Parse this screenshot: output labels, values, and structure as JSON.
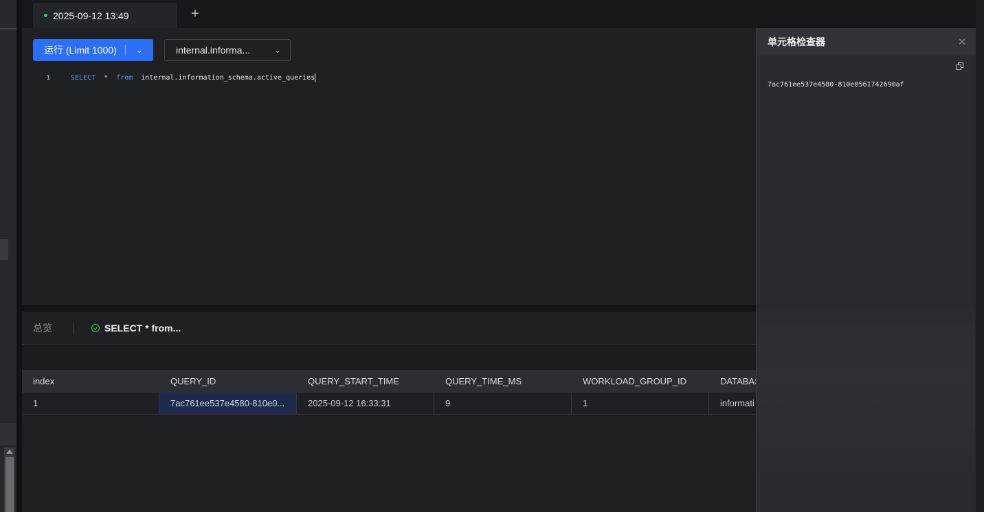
{
  "tab": {
    "title": "2025-09-12 13:49",
    "add_label": "+"
  },
  "toolbar": {
    "run_label": "运行 (Limit 1000)",
    "run_chevron": "⌄",
    "db_value": "internal.informa...",
    "db_chevron": "⌄"
  },
  "editor": {
    "line_number": "1",
    "kw_select": "SELECT",
    "star": "*",
    "kw_from": "from",
    "table": "internal.information_schema.active_queries"
  },
  "results": {
    "overview_label": "总览",
    "result_tab_label": "SELECT * from...",
    "columns": [
      "index",
      "QUERY_ID",
      "QUERY_START_TIME",
      "QUERY_TIME_MS",
      "WORKLOAD_GROUP_ID",
      "DATABAS"
    ],
    "rows": [
      [
        "1",
        "7ac761ee537e4580-810e0...",
        "2025-09-12 16:33:31",
        "9",
        "1",
        "informati"
      ]
    ]
  },
  "inspector": {
    "title": "单元格检查器",
    "close_icon": "close-icon",
    "copy_icon": "copy-icon",
    "value": "7ac761ee537e4580-810e0561742690af"
  },
  "colors": {
    "accent": "#2a6ff5",
    "success": "#2ecc5a",
    "selected_cell": "#1e2b4d"
  }
}
